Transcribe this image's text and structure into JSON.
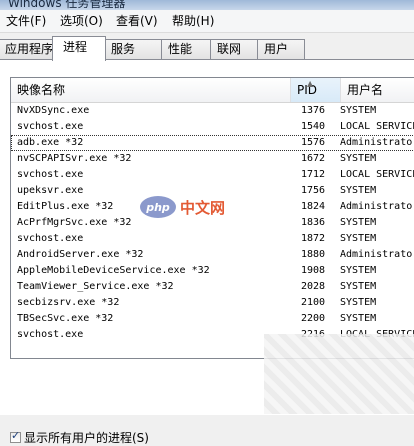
{
  "window": {
    "title": "Windows 任务管理器"
  },
  "menu": {
    "items": [
      {
        "label": "文件(F)"
      },
      {
        "label": "选项(O)"
      },
      {
        "label": "查看(V)"
      },
      {
        "label": "帮助(H)"
      }
    ]
  },
  "tabs": [
    {
      "label": "应用程序"
    },
    {
      "label": "进程"
    },
    {
      "label": "服务"
    },
    {
      "label": "性能"
    },
    {
      "label": "联网"
    },
    {
      "label": "用户"
    }
  ],
  "table": {
    "columns": [
      {
        "label": "映像名称"
      },
      {
        "label": "PID"
      },
      {
        "label": "用户名"
      }
    ],
    "rows": [
      {
        "name": "NvXDSync.exe",
        "pid": "1376",
        "user": "SYSTEM"
      },
      {
        "name": "svchost.exe",
        "pid": "1540",
        "user": "LOCAL SERVICE"
      },
      {
        "name": "adb.exe *32",
        "pid": "1576",
        "user": "Administrator"
      },
      {
        "name": "nvSCPAPISvr.exe *32",
        "pid": "1672",
        "user": "SYSTEM"
      },
      {
        "name": "svchost.exe",
        "pid": "1712",
        "user": "LOCAL SERVICE"
      },
      {
        "name": "upeksvr.exe",
        "pid": "1756",
        "user": "SYSTEM"
      },
      {
        "name": "EditPlus.exe *32",
        "pid": "1824",
        "user": "Administrator"
      },
      {
        "name": "AcPrfMgrSvc.exe *32",
        "pid": "1836",
        "user": "SYSTEM"
      },
      {
        "name": "svchost.exe",
        "pid": "1872",
        "user": "SYSTEM"
      },
      {
        "name": "AndroidServer.exe *32",
        "pid": "1880",
        "user": "Administrator"
      },
      {
        "name": "AppleMobileDeviceService.exe *32",
        "pid": "1908",
        "user": "SYSTEM"
      },
      {
        "name": "TeamViewer_Service.exe *32",
        "pid": "2028",
        "user": "SYSTEM"
      },
      {
        "name": "secbizsrv.exe *32",
        "pid": "2100",
        "user": "SYSTEM"
      },
      {
        "name": "TBSecSvc.exe *32",
        "pid": "2200",
        "user": "SYSTEM"
      },
      {
        "name": "svchost.exe",
        "pid": "2216",
        "user": "LOCAL SERVICE"
      }
    ],
    "selected_index": 2,
    "sort_column": "PID"
  },
  "show_all_users": {
    "label": "显示所有用户的进程(S)",
    "checked": true
  },
  "watermark": {
    "logo": "php",
    "text": "中文网"
  },
  "colors": {
    "tab_border": "#898c95",
    "title_blue": "#9fb9d8",
    "watermark_text": "#e0491f"
  }
}
